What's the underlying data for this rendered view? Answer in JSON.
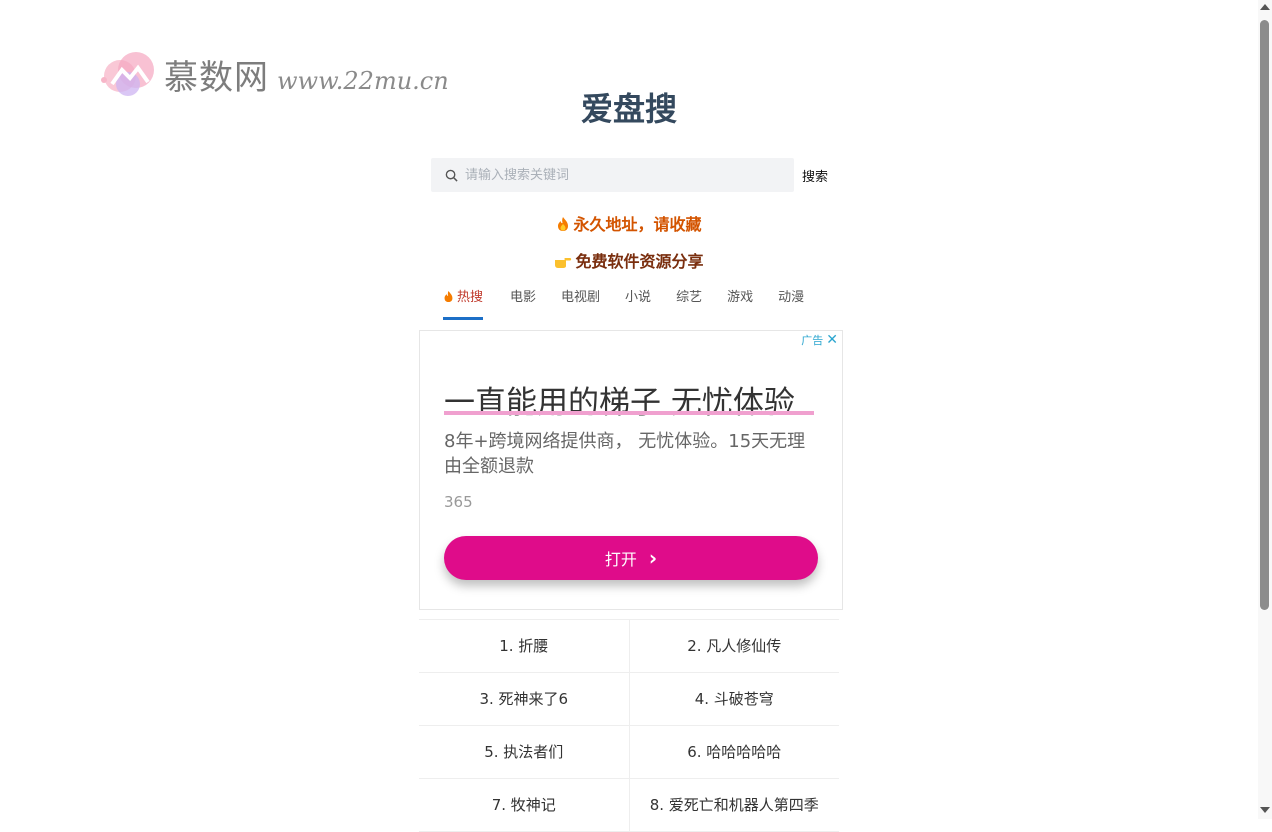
{
  "watermark": {
    "brand": "慕数网",
    "url": "www.22mu.cn"
  },
  "page": {
    "title": "爱盘搜"
  },
  "search": {
    "placeholder": "请输入搜索关键词",
    "button": "搜索"
  },
  "notices": [
    {
      "text": "永久地址，请收藏",
      "icon": "fire-icon"
    },
    {
      "text": "免费软件资源分享",
      "icon": "pointing-hand-icon"
    }
  ],
  "tabs": [
    {
      "label": "热搜",
      "active": true
    },
    {
      "label": "电影"
    },
    {
      "label": "电视剧"
    },
    {
      "label": "小说"
    },
    {
      "label": "综艺"
    },
    {
      "label": "游戏"
    },
    {
      "label": "动漫"
    }
  ],
  "ad": {
    "badge": "广告",
    "close": "✕",
    "headline": "一直能用的梯子 无忧体验",
    "description": "8年+跨境网络提供商， 无忧体验。15天无理由全额退款",
    "source": "365",
    "button": "打开",
    "button_color": "#df0c8a"
  },
  "hot_list": [
    [
      "1. 折腰",
      "2. 凡人修仙传"
    ],
    [
      "3. 死神来了6",
      "4. 斗破苍穹"
    ],
    [
      "5. 执法者们",
      "6. 哈哈哈哈哈"
    ],
    [
      "7. 牧神记",
      "8. 爱死亡和机器人第四季"
    ]
  ],
  "colors": {
    "title": "#34495e",
    "notice1": "#d35400",
    "notice2": "#7a2e0e",
    "tab_active": "#c0392b",
    "tab_underline": "#1c6fc7"
  }
}
